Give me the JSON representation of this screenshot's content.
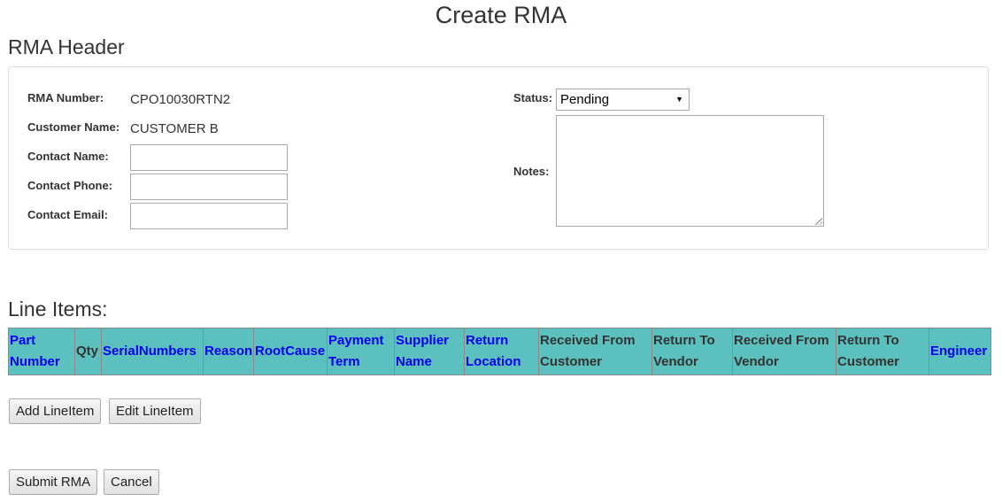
{
  "page": {
    "title": "Create RMA"
  },
  "rma_header": {
    "title": "RMA Header",
    "rma_number_label": "RMA Number:",
    "rma_number_value": "CPO10030RTN2",
    "customer_name_label": "Customer Name:",
    "customer_name_value": "CUSTOMER B",
    "contact_name_label": "Contact Name:",
    "contact_name_value": "",
    "contact_phone_label": "Contact Phone:",
    "contact_phone_value": "",
    "contact_email_label": "Contact Email:",
    "contact_email_value": "",
    "status_label": "Status:",
    "status_value": "Pending",
    "notes_label": "Notes:",
    "notes_value": ""
  },
  "line_items": {
    "title": "Line Items:",
    "columns": [
      {
        "label": "Part Number",
        "sortable": true
      },
      {
        "label": "Qty",
        "sortable": false
      },
      {
        "label": "SerialNumbers",
        "sortable": true
      },
      {
        "label": "Reason",
        "sortable": true
      },
      {
        "label": "RootCause",
        "sortable": true
      },
      {
        "label": "Payment Term",
        "sortable": true
      },
      {
        "label": "Supplier Name",
        "sortable": true
      },
      {
        "label": "Return Location",
        "sortable": true
      },
      {
        "label": "Received From Customer",
        "sortable": false
      },
      {
        "label": "Return To Vendor",
        "sortable": false
      },
      {
        "label": "Received From Vendor",
        "sortable": false
      },
      {
        "label": "Return To Customer",
        "sortable": false
      },
      {
        "label": "Engineer",
        "sortable": true
      }
    ],
    "add_button": "Add LineItem",
    "edit_button": "Edit LineItem"
  },
  "actions": {
    "submit_button": "Submit RMA",
    "cancel_button": "Cancel"
  },
  "colors": {
    "table_header_bg": "#5bc0be",
    "link": "#0000ee"
  }
}
